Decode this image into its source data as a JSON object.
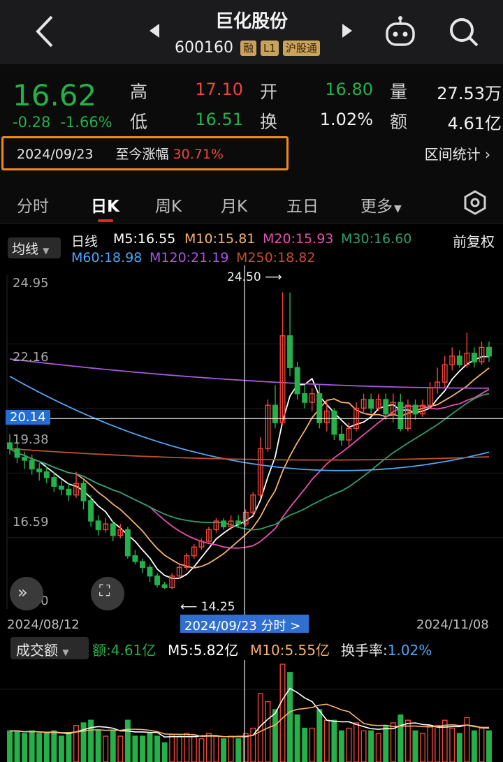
{
  "header": {
    "title": "巨化股份",
    "code": "600160",
    "tags": [
      "融",
      "L1",
      "沪股通"
    ]
  },
  "quote": {
    "price": "16.62",
    "change": "-0.28",
    "change_pct": "-1.66%",
    "high_label": "高",
    "high": "17.10",
    "low_label": "低",
    "low": "16.51",
    "open_label": "开",
    "open": "16.80",
    "turnover_label": "换",
    "turnover": "1.02%",
    "volume_label": "量",
    "volume": "27.53万",
    "amount_label": "额",
    "amount": "4.61亿"
  },
  "range": {
    "date": "2024/09/23",
    "label": "至今涨幅",
    "pct": "30.71%",
    "interval_label": "区间统计"
  },
  "tabs": [
    "分时",
    "日K",
    "周K",
    "月K",
    "五日",
    "更多"
  ],
  "active_tab": 1,
  "ma": {
    "selector": "均线",
    "kline": "日线",
    "m5": "M5:16.55",
    "m10": "M10:15.81",
    "m20": "M20:15.93",
    "m30": "M30:16.60",
    "m60": "M60:18.98",
    "m120": "M120:21.19",
    "m250": "M250:18.82",
    "fuquan": "前复权"
  },
  "colors": {
    "up": "#f0463c",
    "down": "#25b04a",
    "m5": "#ffffff",
    "m10": "#f7b36b",
    "m20": "#e84fb2",
    "m30": "#2e9e6e",
    "m60": "#4ea6f5",
    "m120": "#a858e0",
    "m250": "#c0502c"
  },
  "chart_data": {
    "type": "candlestick",
    "y_ticks": [
      "24.95",
      "22.16",
      "20.14",
      "19.38",
      "16.59",
      "13.80"
    ],
    "crosshair_price": "20.14",
    "max_label": "24.50",
    "min_label": "14.25",
    "x_start": "2024/08/12",
    "x_end": "2024/11/08",
    "selected_date": "2024/09/23",
    "selected_suffix": "分时 >",
    "ylim": [
      13.8,
      24.95
    ],
    "candles": [
      [
        19.3,
        19.1,
        19.6,
        18.9
      ],
      [
        19.1,
        18.8,
        19.3,
        18.6
      ],
      [
        18.8,
        18.7,
        19.0,
        18.4
      ],
      [
        18.7,
        18.4,
        18.9,
        18.2
      ],
      [
        18.4,
        18.3,
        18.6,
        18.0
      ],
      [
        18.3,
        18.1,
        18.5,
        17.9
      ],
      [
        18.1,
        17.8,
        18.3,
        17.6
      ],
      [
        17.8,
        17.7,
        18.0,
        17.5
      ],
      [
        17.7,
        17.5,
        17.9,
        17.3
      ],
      [
        17.5,
        17.9,
        18.3,
        17.4
      ],
      [
        17.9,
        17.3,
        18.0,
        17.0
      ],
      [
        17.3,
        16.6,
        17.5,
        16.4
      ],
      [
        16.6,
        16.3,
        16.8,
        16.1
      ],
      [
        16.3,
        16.5,
        16.7,
        16.2
      ],
      [
        16.5,
        16.1,
        16.6,
        15.9
      ],
      [
        16.1,
        16.3,
        16.5,
        16.0
      ],
      [
        16.3,
        15.4,
        16.4,
        15.3
      ],
      [
        15.4,
        15.2,
        15.6,
        15.1
      ],
      [
        15.2,
        15.0,
        15.3,
        14.8
      ],
      [
        15.0,
        14.7,
        15.1,
        14.5
      ],
      [
        14.7,
        14.4,
        14.8,
        14.3
      ],
      [
        14.4,
        14.3,
        14.5,
        14.25
      ],
      [
        14.3,
        14.7,
        14.8,
        14.25
      ],
      [
        14.7,
        15.0,
        15.1,
        14.6
      ],
      [
        15.0,
        15.4,
        15.5,
        14.9
      ],
      [
        15.4,
        15.7,
        15.8,
        15.3
      ],
      [
        15.7,
        15.9,
        16.0,
        15.6
      ],
      [
        15.9,
        16.3,
        16.4,
        15.8
      ],
      [
        16.3,
        16.6,
        16.7,
        16.2
      ],
      [
        16.6,
        16.4,
        16.7,
        16.3
      ],
      [
        16.4,
        16.6,
        16.8,
        16.3
      ],
      [
        16.6,
        16.5,
        16.8,
        16.4
      ],
      [
        16.5,
        16.9,
        17.0,
        16.4
      ],
      [
        16.9,
        17.5,
        17.6,
        16.8
      ],
      [
        17.5,
        19.1,
        19.5,
        17.4
      ],
      [
        19.1,
        20.6,
        20.8,
        19.0
      ],
      [
        20.6,
        20.0,
        21.3,
        19.8
      ],
      [
        20.0,
        23.0,
        24.5,
        19.9
      ],
      [
        23.0,
        21.9,
        24.5,
        21.6
      ],
      [
        21.9,
        21.0,
        22.1,
        20.8
      ],
      [
        21.0,
        20.7,
        21.3,
        20.5
      ],
      [
        20.7,
        21.0,
        21.2,
        20.4
      ],
      [
        21.0,
        20.0,
        21.3,
        19.8
      ],
      [
        20.0,
        20.4,
        20.8,
        19.7
      ],
      [
        20.4,
        19.6,
        20.5,
        19.4
      ],
      [
        19.6,
        19.4,
        19.9,
        19.2
      ],
      [
        19.4,
        19.8,
        20.0,
        19.2
      ],
      [
        19.8,
        20.5,
        20.7,
        19.7
      ],
      [
        20.5,
        20.8,
        21.0,
        20.3
      ],
      [
        20.8,
        20.5,
        21.0,
        20.3
      ],
      [
        20.5,
        20.8,
        21.0,
        20.4
      ],
      [
        20.8,
        20.3,
        21.0,
        20.1
      ],
      [
        20.3,
        20.7,
        21.0,
        20.0
      ],
      [
        20.7,
        19.8,
        21.0,
        19.7
      ],
      [
        19.8,
        20.6,
        20.8,
        19.7
      ],
      [
        20.6,
        20.3,
        20.8,
        20.1
      ],
      [
        20.3,
        20.6,
        20.8,
        20.2
      ],
      [
        20.6,
        21.2,
        21.4,
        20.5
      ],
      [
        21.2,
        21.4,
        21.9,
        21.0
      ],
      [
        21.4,
        22.0,
        22.3,
        21.2
      ],
      [
        22.0,
        22.3,
        22.6,
        21.8
      ],
      [
        22.3,
        22.0,
        22.5,
        21.9
      ],
      [
        22.0,
        22.4,
        23.1,
        21.9
      ],
      [
        22.4,
        22.1,
        22.6,
        21.9
      ],
      [
        22.1,
        22.6,
        22.8,
        22.0
      ],
      [
        22.6,
        22.3,
        22.8,
        22.1
      ]
    ],
    "volume": {
      "amount_label": "额:4.61亿",
      "m5_label": "M5:5.82亿",
      "m10_label": "M10:5.55亿",
      "turnover_label": "换手率:",
      "turnover_value": "1.02%",
      "selector": "成交额"
    }
  }
}
